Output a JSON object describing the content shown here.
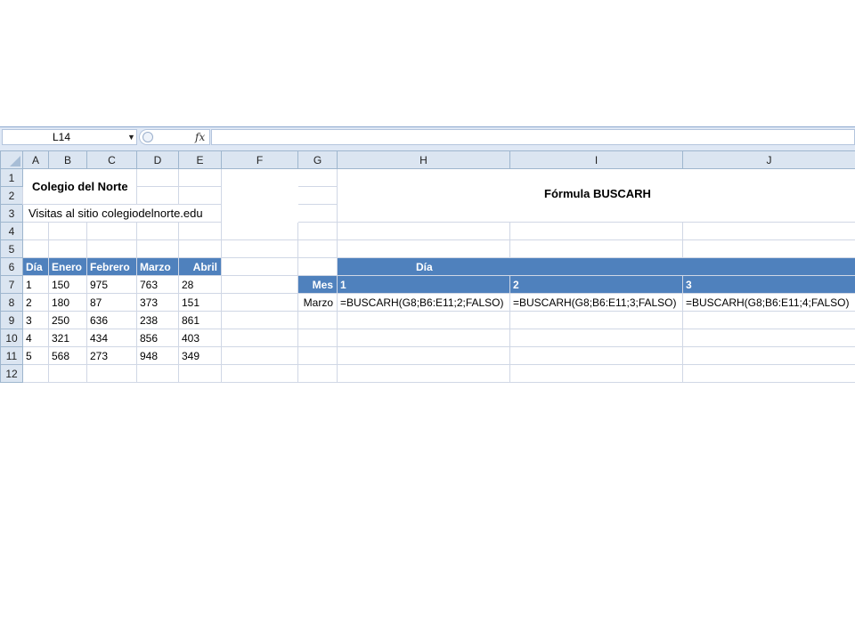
{
  "name_box": "L14",
  "fx_symbol": "fx",
  "columns": [
    "A",
    "B",
    "C",
    "D",
    "E",
    "F",
    "G",
    "H",
    "I",
    "J"
  ],
  "rows": [
    "1",
    "2",
    "3",
    "4",
    "5",
    "6",
    "7",
    "8",
    "9",
    "10",
    "11",
    "12"
  ],
  "cells": {
    "title": "Colegio del Norte",
    "subtitle": "Visitas al sitio colegiodelnorte.edu",
    "formula_title": "Fórmula BUSCARH",
    "table_headers": [
      "Día",
      "Enero",
      "Febrero",
      "Marzo",
      "Abril"
    ],
    "table_rows": [
      [
        "1",
        "150",
        "975",
        "763",
        "28"
      ],
      [
        "2",
        "180",
        "87",
        "373",
        "151"
      ],
      [
        "3",
        "250",
        "636",
        "238",
        "861"
      ],
      [
        "4",
        "321",
        "434",
        "856",
        "403"
      ],
      [
        "5",
        "568",
        "273",
        "948",
        "349"
      ]
    ],
    "dia_label": "Día",
    "mes_label": "Mes",
    "day_numbers": [
      "1",
      "2",
      "3"
    ],
    "mes_value": "Marzo",
    "formulas": [
      "=BUSCARH(G8;B6:E11;2;FALSO)",
      "=BUSCARH(G8;B6:E11;3;FALSO)",
      "=BUSCARH(G8;B6:E11;4;FALSO)"
    ]
  },
  "colors": {
    "header_fill": "#4f81bd",
    "header_text": "#ffffff",
    "chrome": "#dbe5f1"
  }
}
